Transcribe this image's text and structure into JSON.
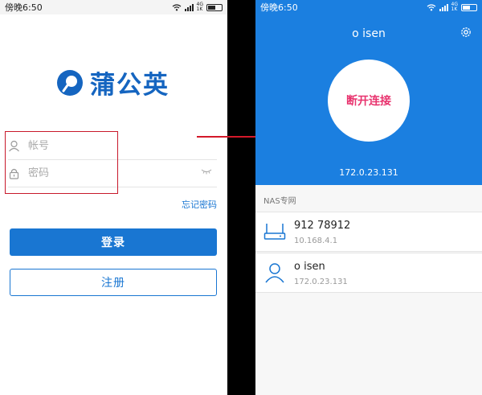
{
  "left_phone": {
    "status": {
      "time": "傍晚6:50",
      "network": "4G",
      "network_sub": "1K"
    },
    "logo": {
      "text": "蒲公英",
      "brand_color": "#1565c0"
    },
    "account_field": {
      "placeholder": "帐号",
      "icon": "user-icon"
    },
    "password_field": {
      "placeholder": "密码",
      "icon": "lock-icon"
    },
    "forgot_password": "忘记密码",
    "login_button": "登录",
    "register_button": "注册",
    "accent_color": "#1976d2",
    "highlight_color": "#c8192b"
  },
  "right_phone": {
    "status": {
      "time": "傍晚6:50",
      "network": "4G",
      "network_sub": "1K"
    },
    "device_name": "o    isen",
    "disconnect_button": "断开连接",
    "ip_address": "172.0.23.131",
    "section_title": "NAS专网",
    "nas_list": [
      {
        "name": "912      78912",
        "ip": "10.168.4.1",
        "icon": "router-icon"
      },
      {
        "name": "o      isen",
        "ip": "172.0.23.131",
        "icon": "user-icon"
      }
    ],
    "header_color": "#1b7fe0",
    "disconnect_color": "#e8336e"
  },
  "arrow_color": "#d3192a"
}
